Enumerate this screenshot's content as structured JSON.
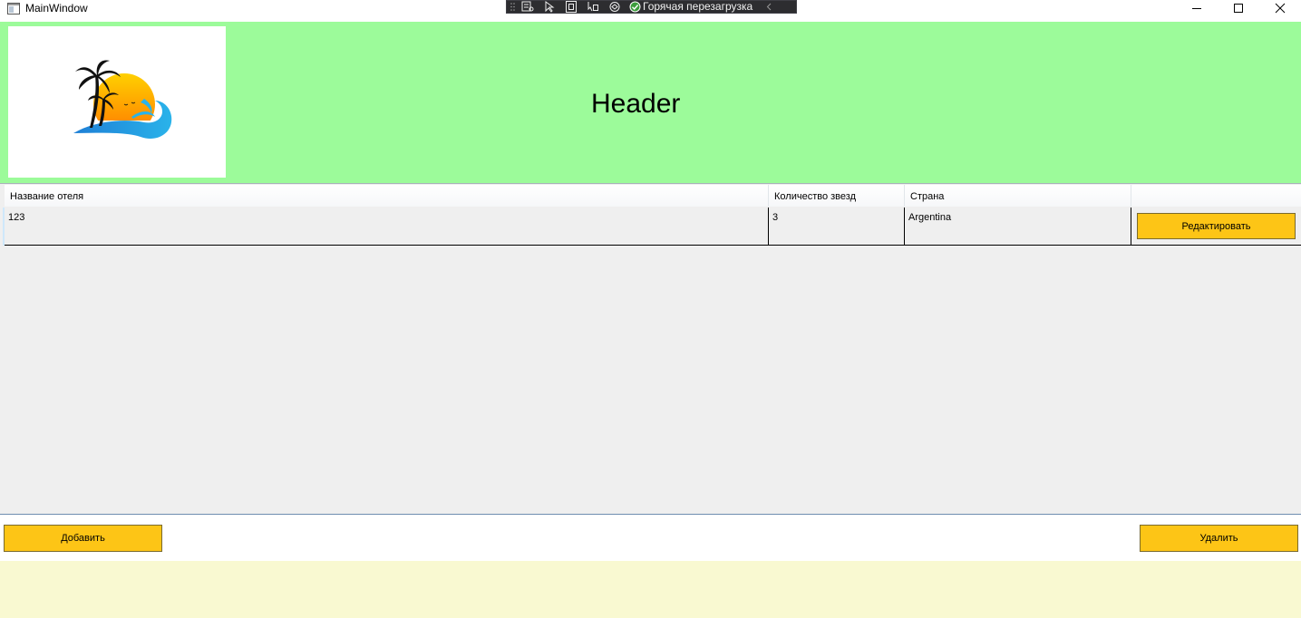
{
  "window": {
    "title": "MainWindow",
    "controls": [
      "minimize-icon",
      "maximize-icon",
      "close-icon"
    ]
  },
  "debug_toolbar": {
    "icons": [
      "live-visual-tree-icon",
      "select-element-icon",
      "display-layout-adorners-icon",
      "track-focused-element-icon",
      "binding-failures-icon"
    ],
    "hot_reload_label": "Горячая перезагрузка"
  },
  "header": {
    "title": "Header",
    "logo": "palm-tree-sunset-wave-logo"
  },
  "grid": {
    "columns": [
      "Название отеля",
      "Количество звезд",
      "Страна",
      ""
    ],
    "rows": [
      {
        "name": "123",
        "stars": "3",
        "country": "Argentina",
        "action_label": "Редактировать"
      }
    ]
  },
  "actions": {
    "add_label": "Добавить",
    "delete_label": "Удалить"
  },
  "colors": {
    "header_bg": "#9cfb9a",
    "button_bg": "#fdc516",
    "grid_bg": "#efefef",
    "footer_bg": "#f9f9d1"
  }
}
